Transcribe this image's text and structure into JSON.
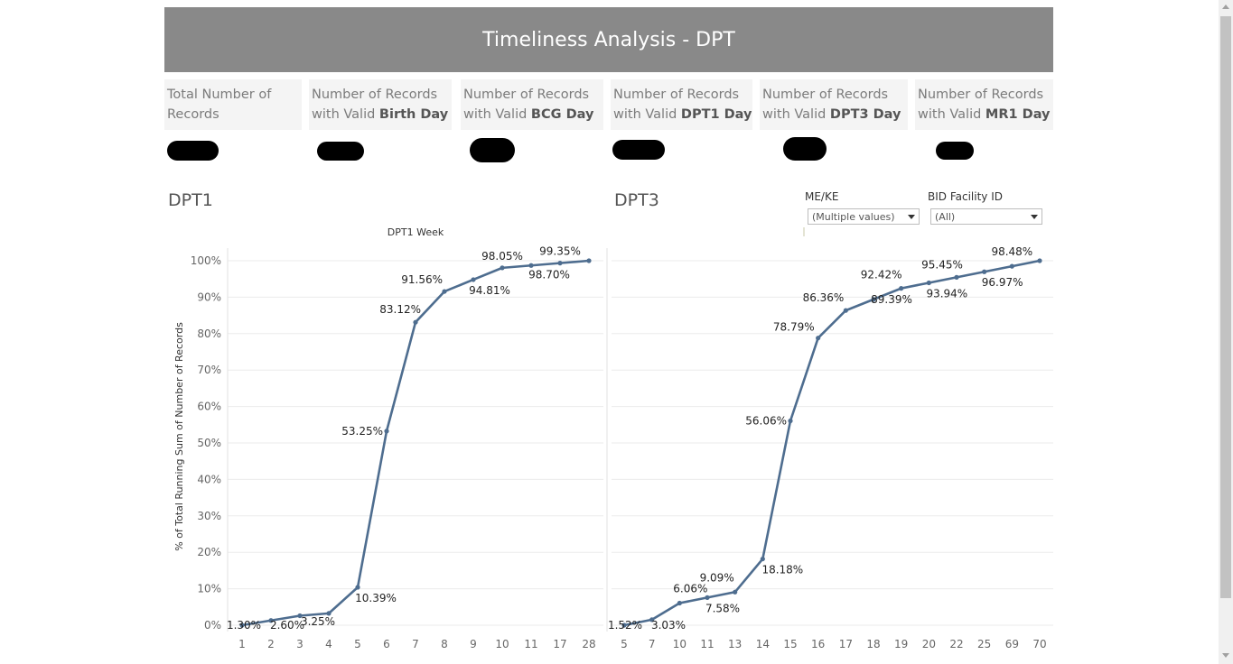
{
  "title": "Timeliness Analysis - DPT",
  "kpis": [
    {
      "line1": "Total Number of",
      "line2": "Records",
      "bold": ""
    },
    {
      "line1": "Number of Records",
      "line2": "with Valid ",
      "bold": "Birth Day"
    },
    {
      "line1": "Number of Records",
      "line2": "with Valid ",
      "bold": "BCG Day"
    },
    {
      "line1": "Number of Records",
      "line2": "with Valid ",
      "bold": "DPT1 Day"
    },
    {
      "line1": "Number of Records",
      "line2": "with Valid ",
      "bold": "DPT3 Day"
    },
    {
      "line1": "Number of Records",
      "line2": "with Valid ",
      "bold": "MR1 Day"
    }
  ],
  "sheets": {
    "left": "DPT1",
    "right": "DPT3"
  },
  "filters": [
    {
      "label": "ME/KE",
      "value": "(Multiple values)"
    },
    {
      "label": "BID Facility ID",
      "value": "(All)"
    }
  ],
  "colors": {
    "line": "#4e6d8f",
    "header": "#898989",
    "grid": "#ebebeb"
  },
  "chart_data": [
    {
      "type": "line",
      "title": "DPT1",
      "xlabel": "DPT1 Week",
      "ylabel": "% of Total Running Sum of Number of Records",
      "ylim": [
        0,
        100
      ],
      "yticks": [
        "0%",
        "10%",
        "20%",
        "30%",
        "40%",
        "50%",
        "60%",
        "70%",
        "80%",
        "90%",
        "100%"
      ],
      "categories": [
        "1",
        "2",
        "3",
        "4",
        "5",
        "6",
        "7",
        "8",
        "9",
        "10",
        "11",
        "17",
        "28"
      ],
      "values": [
        0.0,
        1.3,
        2.6,
        3.25,
        10.39,
        53.25,
        83.12,
        91.56,
        94.81,
        98.05,
        98.7,
        99.35,
        100.0
      ],
      "labels": [
        "1.30%",
        "2.60%",
        "3.25%",
        "",
        "10.39%",
        "53.25%",
        "83.12%",
        "91.56%",
        "94.81%",
        "98.05%",
        "98.70%",
        "99.35%",
        ""
      ],
      "grid": true
    },
    {
      "type": "line",
      "title": "DPT3",
      "xlabel": "",
      "ylabel": "",
      "ylim": [
        0,
        100
      ],
      "categories": [
        "5",
        "7",
        "10",
        "11",
        "13",
        "14",
        "15",
        "16",
        "17",
        "18",
        "19",
        "20",
        "22",
        "25",
        "69",
        "70"
      ],
      "values": [
        0.0,
        1.52,
        6.06,
        7.58,
        9.09,
        18.18,
        56.06,
        78.79,
        86.36,
        89.39,
        92.42,
        93.94,
        95.45,
        96.97,
        98.48,
        100.0
      ],
      "labels": [
        "1.52%",
        "3.03%",
        "6.06%",
        "7.58%",
        "9.09%",
        "18.18%",
        "56.06%",
        "78.79%",
        "86.36%",
        "89.39%",
        "92.42%",
        "93.94%",
        "95.45%",
        "96.97%",
        "98.48%",
        ""
      ],
      "grid": true
    }
  ]
}
